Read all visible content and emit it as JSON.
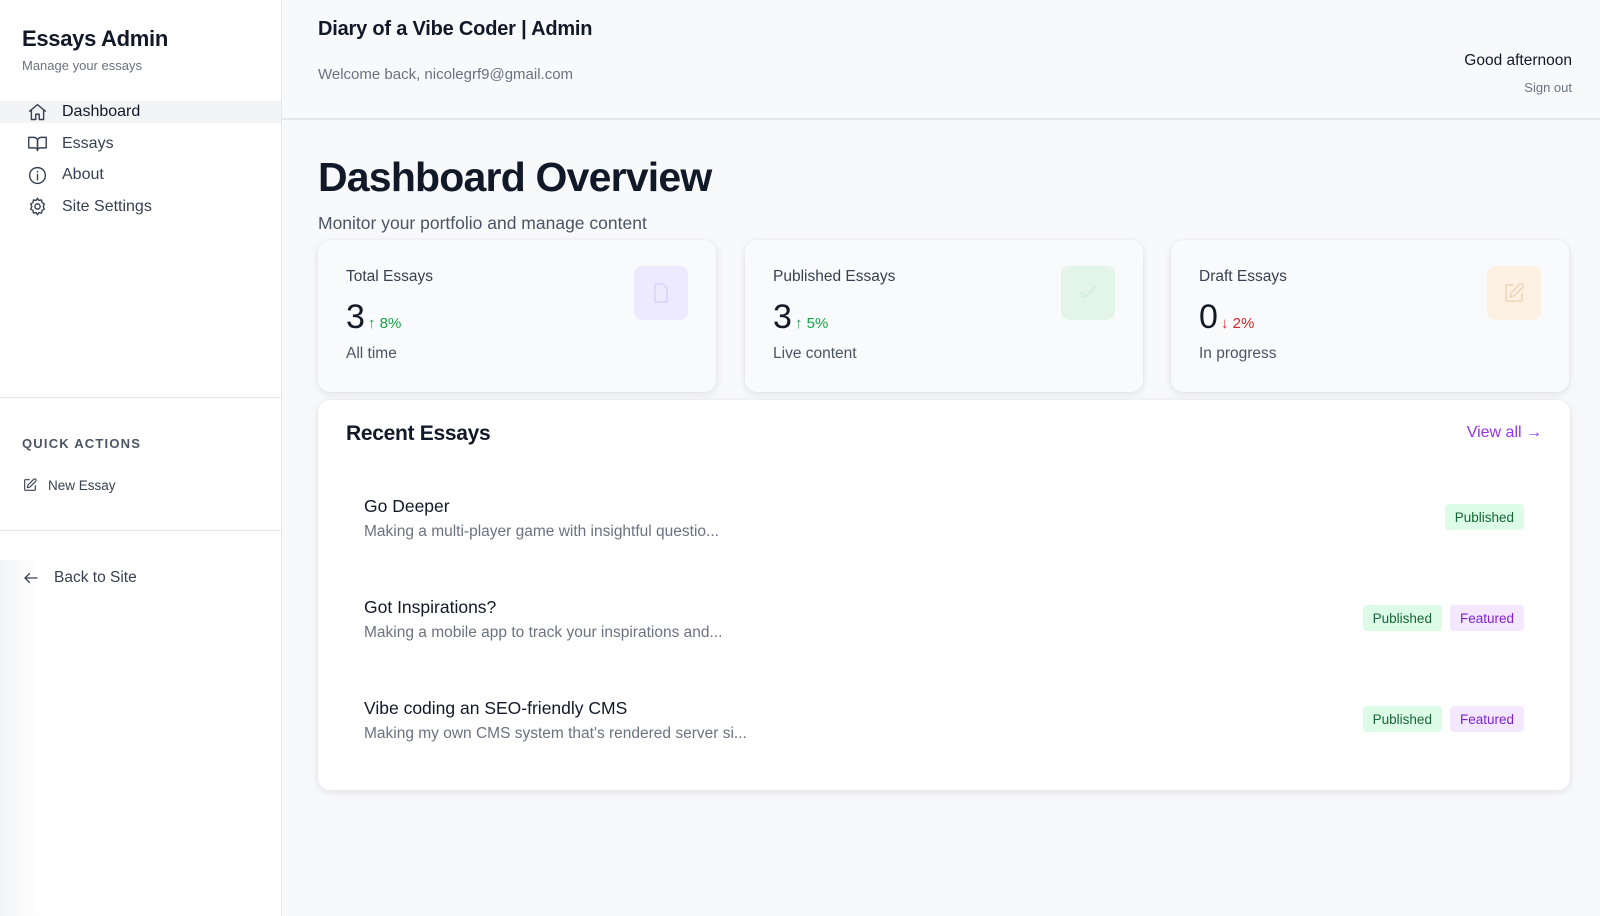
{
  "sidebar": {
    "brand_title": "Essays Admin",
    "brand_subtitle": "Manage your essays",
    "nav": [
      {
        "label": "Dashboard",
        "icon": "home-icon",
        "active": true
      },
      {
        "label": "Essays",
        "icon": "book-icon",
        "active": false
      },
      {
        "label": "About",
        "icon": "info-icon",
        "active": false
      },
      {
        "label": "Site Settings",
        "icon": "gear-icon",
        "active": false
      }
    ],
    "quick_actions_title": "QUICK ACTIONS",
    "new_essay_label": "New Essay",
    "back_label": "Back to Site"
  },
  "header": {
    "site_title": "Diary of a Vibe Coder | Admin",
    "welcome": "Welcome back, nicolegrf9@gmail.com",
    "greeting": "Good afternoon",
    "sign_out": "Sign out"
  },
  "main": {
    "title": "Dashboard Overview",
    "subtitle": "Monitor your portfolio and manage content",
    "stats": [
      {
        "label": "Total Essays",
        "value": "3",
        "trend": "↑ 8%",
        "trend_dir": "up",
        "foot": "All time",
        "icon": "document-icon",
        "icon_bg": "#ede9fe",
        "icon_color": "#c4b5fd"
      },
      {
        "label": "Published Essays",
        "value": "3",
        "trend": "↑ 5%",
        "trend_dir": "up",
        "foot": "Live content",
        "icon": "check-icon",
        "icon_bg": "#dcfce7",
        "icon_color": "#bbf7d0"
      },
      {
        "label": "Draft Essays",
        "value": "0",
        "trend": "↓ 2%",
        "trend_dir": "down",
        "foot": "In progress",
        "icon": "edit-icon",
        "icon_bg": "#fef3e2",
        "icon_color": "#f3d9b1"
      }
    ],
    "recent": {
      "title": "Recent Essays",
      "view_all": "View all →",
      "items": [
        {
          "title": "Go Deeper",
          "excerpt": "Making a multi-player game with insightful questio...",
          "badges": [
            "Published"
          ]
        },
        {
          "title": "Got Inspirations?",
          "excerpt": "Making a mobile app to track your inspirations and...",
          "badges": [
            "Published",
            "Featured"
          ]
        },
        {
          "title": "Vibe coding an SEO-friendly CMS",
          "excerpt": "Making my own CMS system that's rendered server si...",
          "badges": [
            "Published",
            "Featured"
          ]
        }
      ]
    }
  },
  "colors": {
    "accent": "#9333ea",
    "trend_up": "#16a34a",
    "trend_down": "#dc2626",
    "badge_published_bg": "#dcfce7",
    "badge_featured_bg": "#f3e8ff"
  }
}
